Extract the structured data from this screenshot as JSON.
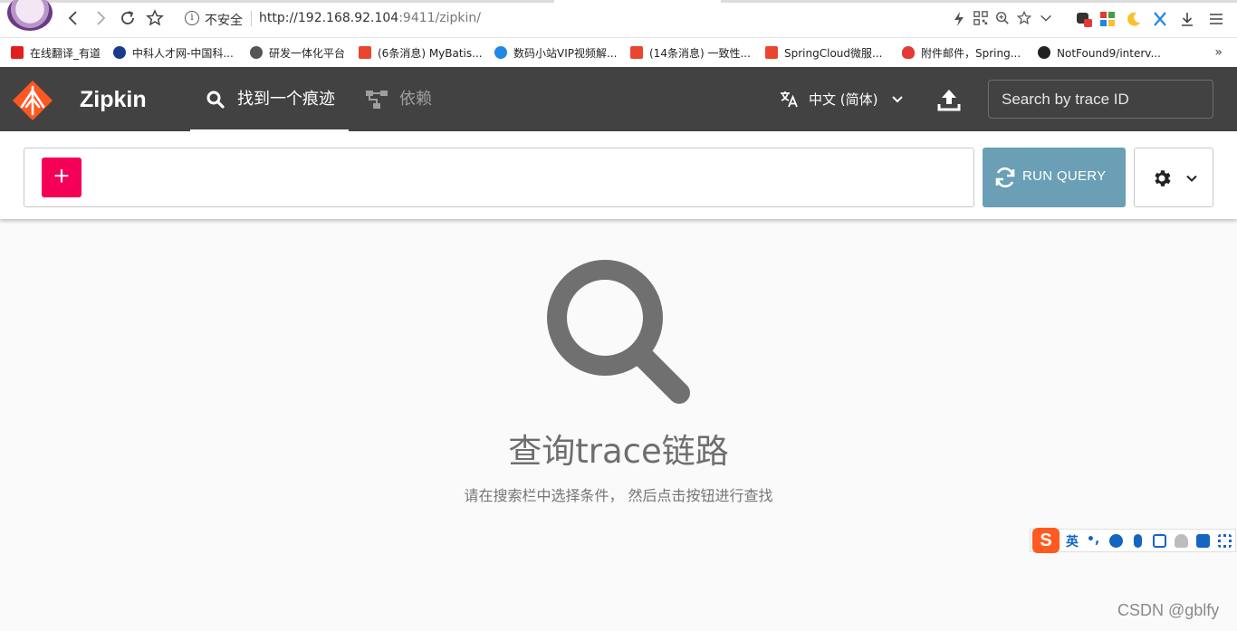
{
  "browser": {
    "insecure_label": "不安全",
    "url_main": "http://192.168.92.104",
    "url_port": ":9411/zipkin/"
  },
  "bookmarks": [
    {
      "label": "在线翻译_有道",
      "color": "#e02020"
    },
    {
      "label": "中科人才网-中国科...",
      "color": "#1a3b8c"
    },
    {
      "label": "研发一体化平台",
      "color": "#555555"
    },
    {
      "label": "(6条消息) MyBatis...",
      "color": "#e8472d"
    },
    {
      "label": "数码小站VIP视频解...",
      "color": "#1e88e5"
    },
    {
      "label": "(14条消息) 一致性...",
      "color": "#e8472d"
    },
    {
      "label": "SpringCloud微服...",
      "color": "#e8472d"
    },
    {
      "label": "附件邮件，Spring...",
      "color": "#e53935"
    },
    {
      "label": "NotFound9/interv...",
      "color": "#222222"
    }
  ],
  "bookmarks_more": "»",
  "app": {
    "brand": "Zipkin",
    "tabs": [
      {
        "label": "找到一个痕迹",
        "icon": "search-icon",
        "active": true
      },
      {
        "label": "依赖",
        "icon": "dependencies-icon",
        "active": false
      }
    ],
    "language": "中文 (简体)",
    "trace_search_placeholder": "Search by trace ID"
  },
  "query": {
    "add_label": "+",
    "run_label": "RUN QUERY"
  },
  "empty_state": {
    "title": "查询trace链路",
    "subtitle": "请在搜索栏中选择条件， 然后点击按钮进行查找"
  },
  "ime": {
    "logo": "S",
    "mode": "英",
    "punct": "•,"
  },
  "watermark": "CSDN @gblfy",
  "colors": {
    "header_bg": "#424242",
    "add_button": "#f50057",
    "run_button": "#6a9fb5",
    "logo": "#ff5722"
  }
}
